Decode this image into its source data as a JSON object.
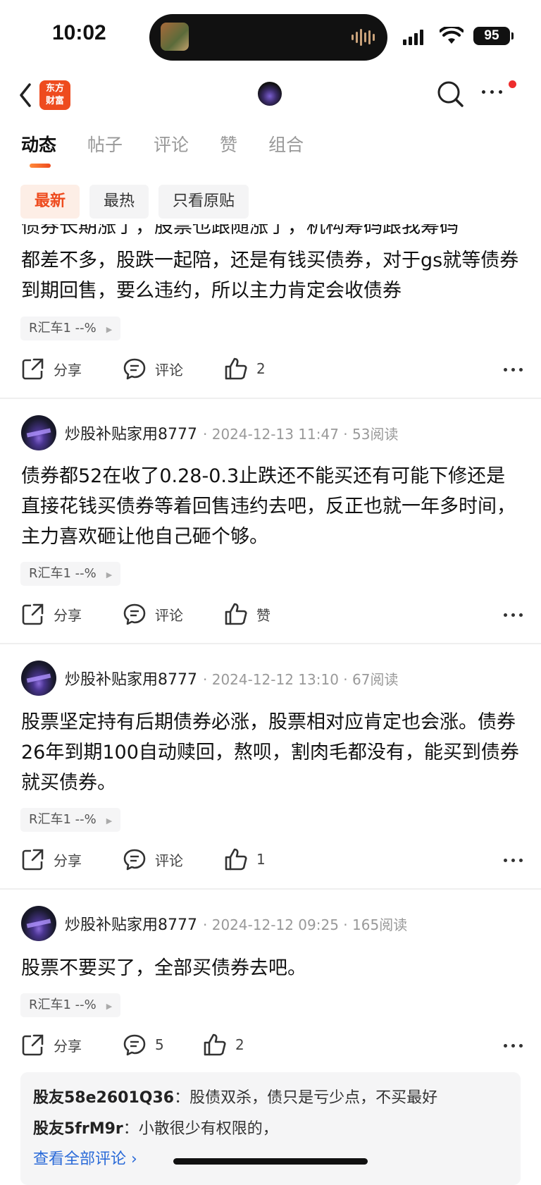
{
  "status": {
    "time": "10:02",
    "battery": "95"
  },
  "nav": {
    "logo_line1": "东方",
    "logo_line2": "财富"
  },
  "tabs": [
    "动态",
    "帖子",
    "评论",
    "赞",
    "组合"
  ],
  "filters": [
    "最新",
    "最热",
    "只看原贴"
  ],
  "posts": [
    {
      "content_partial_top": "债券长期涨了，股票也跟随涨了，机构筹码跟我筹码",
      "content": "都差不多，股跌一起陪，还是有钱买债券，对于gs就等债券到期回售，要么违约，所以主力肯定会收债券",
      "stock": "R汇车1 --%",
      "share": "分享",
      "comment": "评论",
      "like": "2"
    },
    {
      "author": "炒股补贴家用8777",
      "datetime": "2024-12-13 11:47",
      "reads": "53阅读",
      "content": "债券都52在收了0.28-0.3止跌还不能买还有可能下修还是直接花钱买债券等着回售违约去吧，反正也就一年多时间，主力喜欢砸让他自己砸个够。",
      "stock": "R汇车1 --%",
      "share": "分享",
      "comment": "评论",
      "like": "赞"
    },
    {
      "author": "炒股补贴家用8777",
      "datetime": "2024-12-12 13:10",
      "reads": "67阅读",
      "content": "股票坚定持有后期债券必涨，股票相对应肯定也会涨。债券26年到期100自动赎回，熬呗，割肉毛都没有，能买到债券就买债券。",
      "stock": "R汇车1 --%",
      "share": "分享",
      "comment": "评论",
      "like": "1"
    },
    {
      "author": "炒股补贴家用8777",
      "datetime": "2024-12-12 09:25",
      "reads": "165阅读",
      "content": "股票不要买了，全部买债券去吧。",
      "stock": "R汇车1 --%",
      "share": "分享",
      "comment": "5",
      "like": "2"
    }
  ],
  "comments": [
    {
      "user": "股友58e2601Q36",
      "text": "股债双杀，债只是亏少点，不买最好"
    },
    {
      "user": "股友5frM9r",
      "text": "小散很少有权限的，"
    }
  ],
  "view_all": "查看全部评论 ›",
  "colors": {
    "accent": "#ee4b1e",
    "link": "#2a6ad8"
  }
}
